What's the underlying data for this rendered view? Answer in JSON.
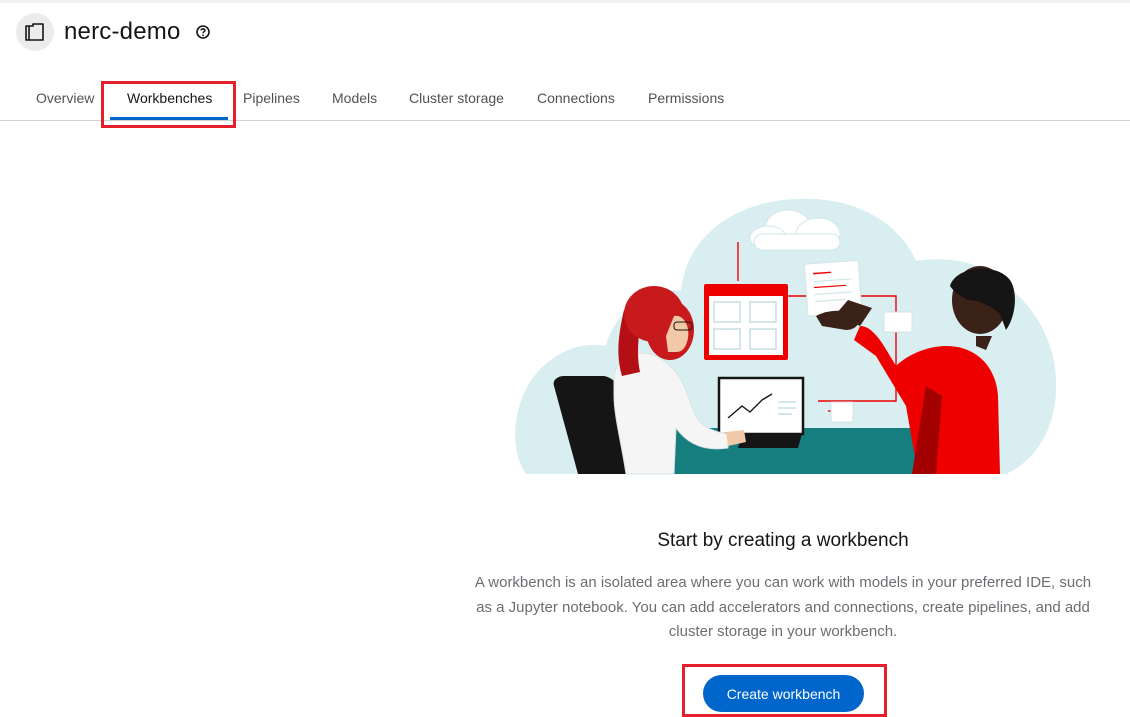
{
  "project": {
    "name": "nerc-demo",
    "icon": "project-folder-icon",
    "help_icon": "help-circle-icon"
  },
  "tabs": [
    {
      "label": "Overview",
      "active": false
    },
    {
      "label": "Workbenches",
      "active": true
    },
    {
      "label": "Pipelines",
      "active": false
    },
    {
      "label": "Models",
      "active": false
    },
    {
      "label": "Cluster storage",
      "active": false
    },
    {
      "label": "Connections",
      "active": false
    },
    {
      "label": "Permissions",
      "active": false
    }
  ],
  "empty_state": {
    "title": "Start by creating a workbench",
    "body": "A workbench is an isolated area where you can work with models in your preferred IDE, such as a Jupyter notebook. You can add accelerators and connections, create pipelines, and add cluster storage in your workbench.",
    "button_label": "Create workbench"
  },
  "colors": {
    "accent": "#0066cc",
    "annotation": "#e4202e"
  }
}
